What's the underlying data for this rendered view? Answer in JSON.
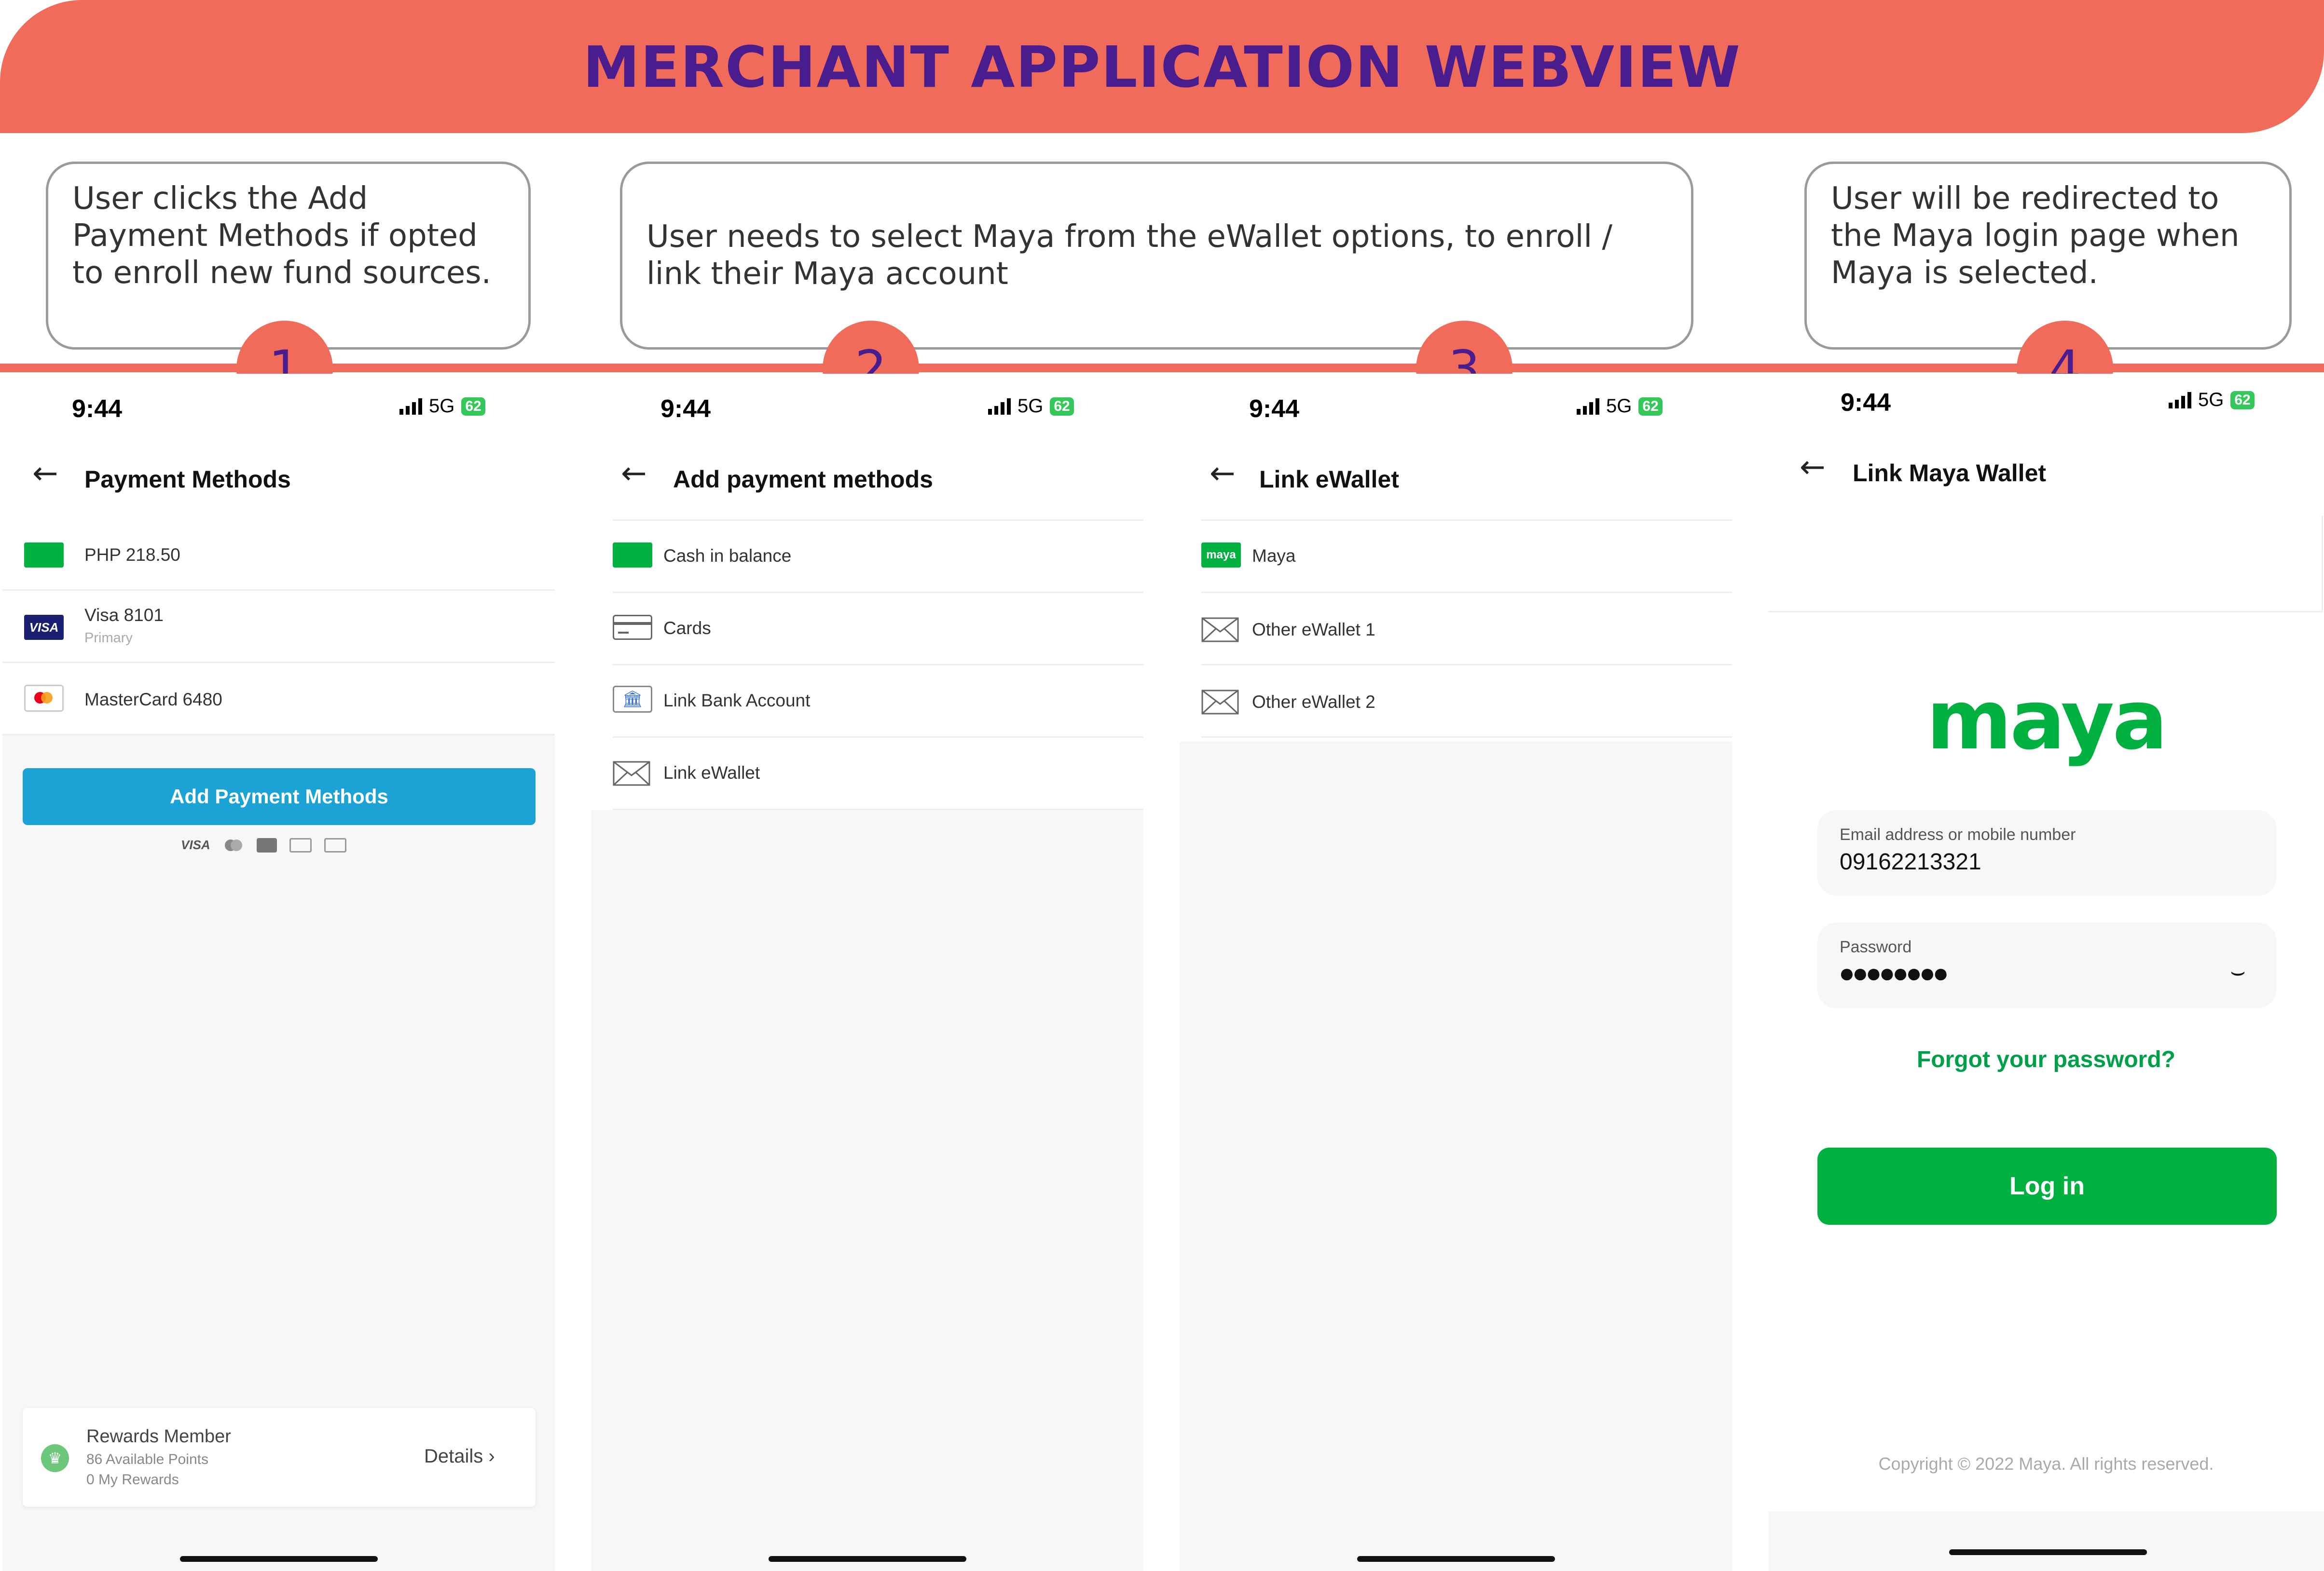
{
  "banner": {
    "title": "MERCHANT APPLICATION WEBVIEW"
  },
  "callouts": [
    {
      "step": "1",
      "text": "User clicks the Add Payment Methods if opted to enroll new fund sources."
    },
    {
      "step": "2",
      "text": "User needs to select Maya from the eWallet options, to enroll / link their Maya account"
    },
    {
      "step": "3",
      "text": ""
    },
    {
      "step": "4",
      "text": "User will be redirected to the Maya login page when Maya is selected."
    }
  ],
  "status": {
    "time": "9:44",
    "network": "5G",
    "battery": "62"
  },
  "screen1": {
    "title": "Payment Methods",
    "items": [
      {
        "label": "PHP 218.50",
        "sub": ""
      },
      {
        "label": "Visa 8101",
        "sub": "Primary"
      },
      {
        "label": "MasterCard 6480",
        "sub": ""
      }
    ],
    "add_button": "Add Payment Methods",
    "card_logos": {
      "visa": "VISA"
    },
    "rewards": {
      "title": "Rewards Member",
      "points": "86 Available Points",
      "rewards": "0 My Rewards",
      "details": "Details"
    }
  },
  "screen2": {
    "title": "Add payment methods",
    "items": [
      "Cash in balance",
      "Cards",
      "Link Bank Account",
      "Link eWallet"
    ]
  },
  "screen3": {
    "title": "Link eWallet",
    "items": [
      "Maya",
      "Other eWallet 1",
      "Other eWallet 2"
    ],
    "maya_badge": "maya"
  },
  "screen4": {
    "title": "Link Maya Wallet",
    "logo": "maya",
    "email_label": "Email address or mobile number",
    "email_value": "09162213321",
    "password_label": "Password",
    "password_value": "●●●●●●●●",
    "forgot": "Forgot your password?",
    "login": "Log in",
    "copyright": "Copyright © 2022 Maya. All rights reserved."
  },
  "colors": {
    "banner": "#f06b59",
    "title": "#4a1d8f",
    "maya_green": "#00b140",
    "add_button": "#1aa3d4"
  }
}
